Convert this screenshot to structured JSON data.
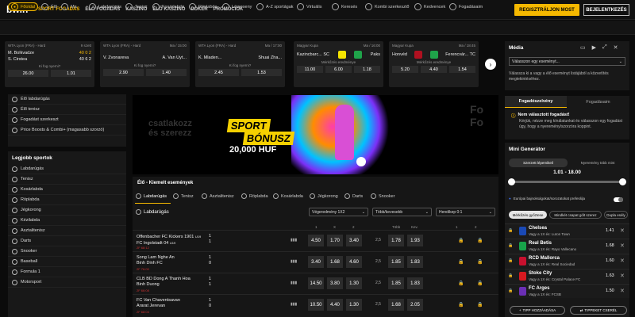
{
  "header": {
    "logo": "bwin",
    "nav": [
      "SPORT FOGADÁS",
      "ÉLŐ FOGADÁS",
      "KASZINÓ",
      "ÉLŐ KASZINÓ",
      "PÓKER",
      "PROMÓCIÓK"
    ],
    "register_label": "REGISZTRÁLJON MOST",
    "login_label": "BEJELENTKEZÉS"
  },
  "sports_bar": {
    "items": [
      "Főoldal",
      "Élő",
      "Ma",
      "Labdarúgás",
      "Tenisz",
      "Kosárlabda",
      "Röplabda",
      "Lóverseny",
      "A-Z sportágak",
      "Virtuális",
      "Keresés",
      "Kombi szerkesztő",
      "Kedvencek",
      "Fogadásaim"
    ]
  },
  "match_cards": [
    {
      "league": "WTA Lyon (FRA) - Hard",
      "time": "9 szett",
      "team1": "M. Bolkvadze",
      "team2": "S. Cirstea",
      "score1": "40 0 2",
      "score2": "40 6 2",
      "label": "Ki fog nyerni?",
      "odd1": "26.00",
      "odd2": "1.01"
    },
    {
      "league": "WTA Lyon (FRA) - Hard",
      "time": "Ma / 15:00",
      "team1": "V. Zvonareva",
      "team2": "A. Van Uyt...",
      "label": "Ki fog nyerni?",
      "odd1": "2.90",
      "odd2": "1.40"
    },
    {
      "league": "WTA Lyon (FRA) - Hard",
      "time": "Ma / 17:00",
      "team1": "K. Mladen...",
      "team2": "Shuai Zha...",
      "label": "Ki fog nyerni?",
      "odd1": "2.45",
      "odd2": "1.53"
    },
    {
      "league": "Magyar Kupa",
      "time": "Ma / 16:00",
      "team1": "Kazincbarc... SC",
      "team2": "Paks",
      "label": "Mérkőzés eredménye",
      "odds3": [
        "11.00",
        "6.00",
        "1.18"
      ]
    },
    {
      "league": "Magyar Kupa",
      "time": "Ma / 18:45",
      "team1": "Honvéd",
      "team2": "Ferencvár... TC",
      "label": "Mérkőzés eredménye",
      "odds3": [
        "5.20",
        "4.40",
        "1.54"
      ]
    }
  ],
  "left_sidebar": {
    "quick": [
      "Élő labdarúgás",
      "Élő tenisz",
      "Fogadást szerkeszt",
      "Price Boosts & Combi+ (magasabb szorzó)"
    ],
    "top_sports_title": "Legjobb sportok",
    "sports": [
      "Labdarúgás",
      "Tenisz",
      "Kosárlabda",
      "Röplabda",
      "Jégkorong",
      "Kézilabda",
      "Asztalitenisz",
      "Darts",
      "Snooker",
      "Baseball",
      "Formula 1",
      "Motorsport"
    ]
  },
  "banner": {
    "line1": "SPORT",
    "line2": "BÓNUSZ",
    "line3": "20,000 HUF",
    "ghost_left": "csatlakozz\nés szerezz",
    "ghost_right": "Fo\nFo"
  },
  "events": {
    "title": "Élő - Kiemelt események",
    "tabs": [
      "Labdarúgás",
      "Tenisz",
      "Asztalitenisz",
      "Röplabda",
      "Kosárlabda",
      "Jégkorong",
      "Darts",
      "Snooker"
    ],
    "section": "Labdarúgás",
    "selects": [
      "Végeredmény 1X2",
      "Több/kevesebb",
      "Hendikep 0:1"
    ],
    "headers": [
      "1",
      "X",
      "2",
      "Több",
      "Kev.",
      "1",
      "2"
    ],
    "rows": [
      {
        "team1": "Offenbacher FC Kickers 1901",
        "team1_tag": "U19",
        "team2": "FC Ingolstadt 04",
        "team2_tag": "U19",
        "score1": "1",
        "score2": "1",
        "meta": "2F 68:12",
        "odds": [
          "4.50",
          "1.70",
          "3.40"
        ],
        "ou_line": "2,5",
        "ou": [
          "1.78",
          "1.93"
        ]
      },
      {
        "team1": "Song Lam Nghe An",
        "team2": "Binh Dinh FC",
        "score1": "1",
        "score2": "0",
        "meta": "2F 76:00",
        "odds": [
          "3.40",
          "1.68",
          "4.60"
        ],
        "ou_line": "2,5",
        "ou": [
          "1.85",
          "1.83"
        ]
      },
      {
        "team1": "CLB BD Dong A Thanh Hoa",
        "team2": "Binh Duong",
        "score1": "1",
        "score2": "1",
        "meta": "2F 66:08",
        "odds": [
          "14.50",
          "3.80",
          "1.30"
        ],
        "ou_line": "2,5",
        "ou": [
          "1.85",
          "1.83"
        ]
      },
      {
        "team1": "FC Van Chaventsavan",
        "team2": "Ararat Jerevan",
        "score1": "1",
        "score2": "0",
        "meta": "2F 68:04",
        "odds": [
          "10.50",
          "4.40",
          "1.30"
        ],
        "ou_line": "2,5",
        "ou": [
          "1.68",
          "2.05"
        ]
      }
    ]
  },
  "right_panel": {
    "media_title": "Média",
    "media_select": "Válasszon egy eseményt...",
    "media_hint": "Válassza ki a  vagy a  élő eseményt listájából a közvetítés megtekintéséhez.",
    "tabs": [
      "Fogadószelvény",
      "Fogadásaim"
    ],
    "empty_title": "Nem választott fogadást!",
    "empty_text": "Kérjük, nézze meg kínálatunkat és válasszon egy fogadást úgy, hogy a nyeremény/szorzóra koppint.",
    "generator_title": "Mini Generátor",
    "gen_tabs": [
      "Szerzett lépemikeil",
      "Nyeremény több mint"
    ],
    "range": "1.01 - 18.00",
    "pref_label": "Európai bajnokságokat/sorozatokat preferálja",
    "chips": [
      "Mérkőzés győztese",
      "Mindkét csapat gólt szerez",
      "Dupla esély"
    ],
    "picks": [
      {
        "team": "Chelsea",
        "sub": "Vagy a 1X és: Luton Town",
        "odd": "1.41",
        "color": "#1a49b5"
      },
      {
        "team": "Real Betis",
        "sub": "Vagy a 1X és: Rayo Vallecano",
        "odd": "1.68",
        "color": "#18a34a"
      },
      {
        "team": "RCD Mallorca",
        "sub": "Vagy a 1X és: Real Sociedad",
        "odd": "1.60",
        "color": "#c8102e"
      },
      {
        "team": "Stoke City",
        "sub": "Vagy a 1X és: Crystal Palace FC",
        "odd": "1.63",
        "color": "#d71920"
      },
      {
        "team": "FC Arges",
        "sub": "Vagy a 1X és: FCSB",
        "odd": "1.50",
        "color": "#6b2fb5"
      }
    ],
    "add_label": "TIPP HOZZÁADÁSA",
    "shuffle_label": "TIPPEKET CSERÉL"
  }
}
